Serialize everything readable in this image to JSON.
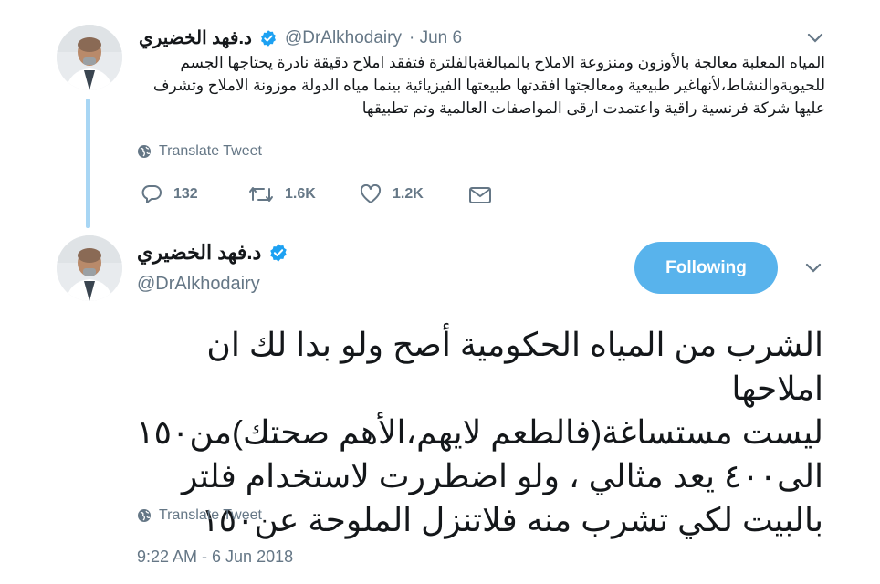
{
  "tweet1": {
    "author_name": "د.فهد الخضيري",
    "handle": "@DrAlkhodairy",
    "date": "· Jun 6",
    "lines": [
      "المياه المعلبة معالجة بالأوزون ومنزوعة الاملاح بالمبالغةبالفلترة فتفقد املاح دقيقة نادرة يحتاجها الجسم",
      "للحيويةوالنشاط،لأنهاغير طبيعية ومعالجتها افقدتها طبيعتها الفيزيائية بينما مياه الدولة موزونة الاملاح وتشرف",
      "عليها شركة فرنسية راقية واعتمدت ارقى المواصفات العالمية وتم تطبيقها"
    ],
    "translate_label": "Translate Tweet",
    "replies": "132",
    "retweets": "1.6K",
    "likes": "1.2K"
  },
  "tweet2": {
    "author_name": "د.فهد الخضيري",
    "handle": "@DrAlkhodairy",
    "follow_label": "Following",
    "lines": [
      "الشرب من المياه الحكومية أصح ولو بدا لك ان املاحها",
      "ليست مستساغة(فالطعم لايهم،الأهم صحتك)من١٥٠",
      "الى٤٠٠ يعد مثالي ، ولو اضطررت لاستخدام فلتر",
      "بالبيت لكي تشرب منه فلاتنزل الملوحة عن١٥٠"
    ],
    "translate_label": "Translate Tweet",
    "timestamp": "9:22 AM - 6 Jun 2018"
  },
  "colors": {
    "accent": "#1da1f2",
    "follow_bg": "#58b3ec",
    "muted": "#657786",
    "thread_line": "#a8d6f4"
  },
  "icons": [
    "avatar",
    "verified-badge-icon",
    "chevron-down-icon",
    "globe-icon",
    "reply-icon",
    "retweet-icon",
    "like-icon",
    "message-icon"
  ]
}
